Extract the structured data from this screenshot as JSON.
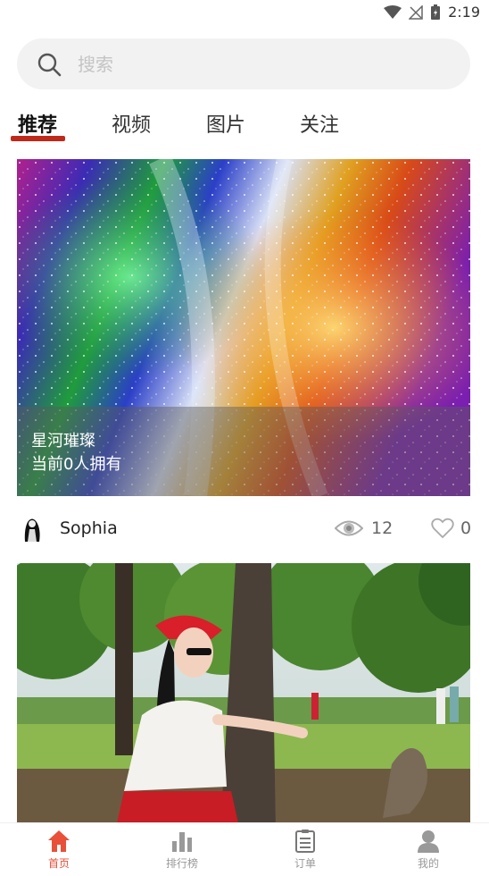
{
  "status_bar": {
    "time": "2:19"
  },
  "search": {
    "placeholder": "搜索",
    "value": ""
  },
  "tabs": [
    {
      "label": "推荐",
      "active": true
    },
    {
      "label": "视频",
      "active": false
    },
    {
      "label": "图片",
      "active": false
    },
    {
      "label": "关注",
      "active": false
    }
  ],
  "cards": [
    {
      "title": "星河璀璨",
      "subtitle": "当前0人拥有",
      "author": "Sophia",
      "views": "12",
      "likes": "0"
    }
  ],
  "bottom_nav": [
    {
      "label": "首页",
      "icon": "home-icon",
      "active": true
    },
    {
      "label": "排行榜",
      "icon": "bar-chart-icon",
      "active": false
    },
    {
      "label": "订单",
      "icon": "clipboard-icon",
      "active": false
    },
    {
      "label": "我的",
      "icon": "user-icon",
      "active": false
    }
  ],
  "colors": {
    "accent": "#c0281b",
    "nav_active": "#e8503a",
    "nav_inactive": "#999999"
  }
}
